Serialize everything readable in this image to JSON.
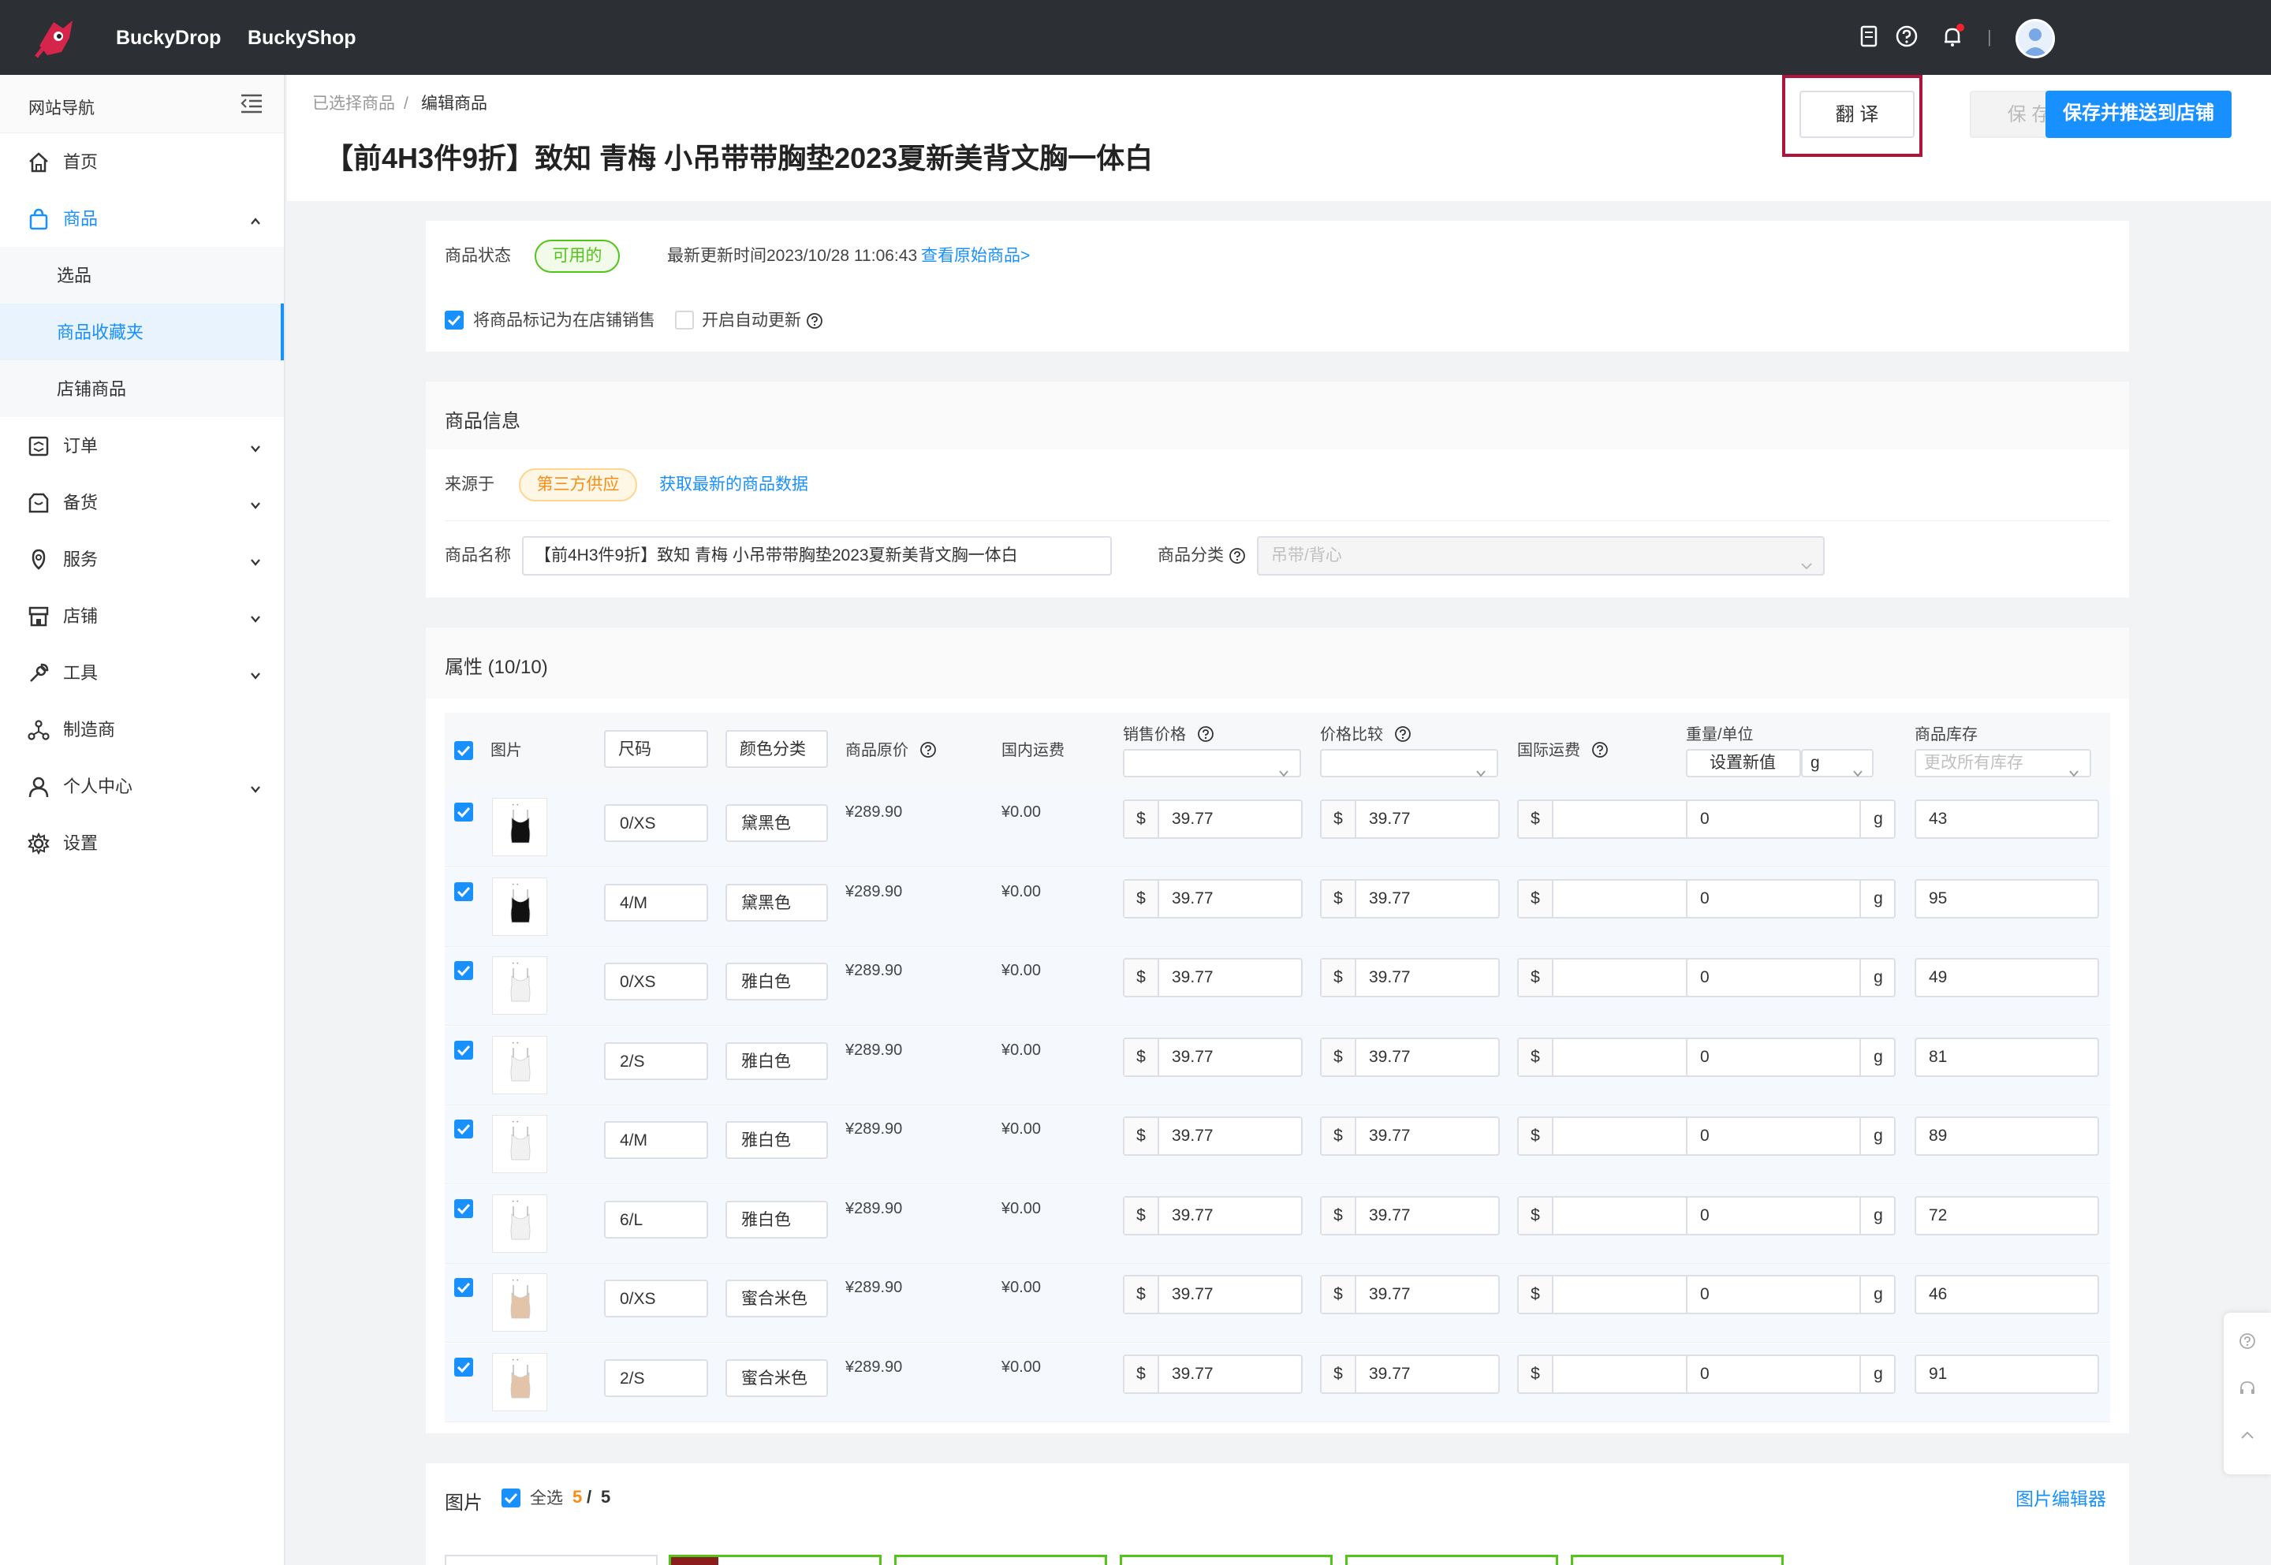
{
  "topbar": {
    "brand1": "BuckyDrop",
    "brand2": "BuckyShop",
    "icons": [
      "document-icon",
      "help-icon",
      "bell-icon"
    ],
    "separator": "|"
  },
  "sidebar": {
    "header": "网站导航",
    "items": [
      {
        "label": "首页",
        "icon": "home-icon"
      },
      {
        "label": "商品",
        "icon": "bag-icon",
        "expanded": true,
        "sub": [
          {
            "label": "选品"
          },
          {
            "label": "商品收藏夹",
            "active": true
          },
          {
            "label": "店铺商品"
          }
        ]
      },
      {
        "label": "订单",
        "icon": "order-icon"
      },
      {
        "label": "备货",
        "icon": "box-icon"
      },
      {
        "label": "服务",
        "icon": "service-icon"
      },
      {
        "label": "店铺",
        "icon": "store-icon"
      },
      {
        "label": "工具",
        "icon": "wrench-icon"
      },
      {
        "label": "制造商",
        "icon": "network-icon"
      },
      {
        "label": "个人中心",
        "icon": "user-icon"
      },
      {
        "label": "设置",
        "icon": "gear-icon"
      }
    ]
  },
  "header": {
    "breadcrumb_1": "已选择商品",
    "breadcrumb_sep": "/",
    "breadcrumb_2": "编辑商品",
    "title": "【前4H3件9折】致知 青梅 小吊带带胸垫2023夏新美背文胸一体白",
    "translate_btn": "翻 译",
    "save_btn": "保 存",
    "save_push_btn": "保存并推送到店铺"
  },
  "status": {
    "label": "商品状态",
    "badge": "可用的",
    "updated": "最新更新时间2023/10/28 11:06:43",
    "view_original": "查看原始商品>",
    "mark_sale": "将商品标记为在店铺销售",
    "auto_update": "开启自动更新"
  },
  "info": {
    "section_title": "商品信息",
    "source_label": "来源于",
    "source_tag": "第三方供应",
    "fetch_link": "获取最新的商品数据",
    "name_label": "商品名称",
    "name_value": "【前4H3件9折】致知 青梅 小吊带带胸垫2023夏新美背文胸一体白",
    "category_label": "商品分类",
    "category_placeholder": "吊带/背心"
  },
  "attributes": {
    "section_title": "属性 (10/10)",
    "headers": {
      "image": "图片",
      "size": "尺码",
      "color": "颜色分类",
      "orig_price": "商品原价",
      "dom_ship": "国内运费",
      "sale_price": "销售价格",
      "compare": "价格比较",
      "intl_ship": "国际运费",
      "weight": "重量/单位",
      "weight_set": "设置新值",
      "weight_unit": "g",
      "stock": "商品库存",
      "stock_placeholder": "更改所有库存"
    },
    "currency": "$",
    "unit": "g",
    "rows": [
      {
        "size": "0/XS",
        "color": "黛黑色",
        "orig": "¥289.90",
        "ship": "¥0.00",
        "price": "39.77",
        "compare": "39.77",
        "weight": "0",
        "stock": "43",
        "swatch": "#111111"
      },
      {
        "size": "4/M",
        "color": "黛黑色",
        "orig": "¥289.90",
        "ship": "¥0.00",
        "price": "39.77",
        "compare": "39.77",
        "weight": "0",
        "stock": "95",
        "swatch": "#111111"
      },
      {
        "size": "0/XS",
        "color": "雅白色",
        "orig": "¥289.90",
        "ship": "¥0.00",
        "price": "39.77",
        "compare": "39.77",
        "weight": "0",
        "stock": "49",
        "swatch": "#f1f1f1"
      },
      {
        "size": "2/S",
        "color": "雅白色",
        "orig": "¥289.90",
        "ship": "¥0.00",
        "price": "39.77",
        "compare": "39.77",
        "weight": "0",
        "stock": "81",
        "swatch": "#f1f1f1"
      },
      {
        "size": "4/M",
        "color": "雅白色",
        "orig": "¥289.90",
        "ship": "¥0.00",
        "price": "39.77",
        "compare": "39.77",
        "weight": "0",
        "stock": "89",
        "swatch": "#f1f1f1"
      },
      {
        "size": "6/L",
        "color": "雅白色",
        "orig": "¥289.90",
        "ship": "¥0.00",
        "price": "39.77",
        "compare": "39.77",
        "weight": "0",
        "stock": "72",
        "swatch": "#f1f1f1"
      },
      {
        "size": "0/XS",
        "color": "蜜合米色",
        "orig": "¥289.90",
        "ship": "¥0.00",
        "price": "39.77",
        "compare": "39.77",
        "weight": "0",
        "stock": "46",
        "swatch": "#e3c4a8"
      },
      {
        "size": "2/S",
        "color": "蜜合米色",
        "orig": "¥289.90",
        "ship": "¥0.00",
        "price": "39.77",
        "compare": "39.77",
        "weight": "0",
        "stock": "91",
        "swatch": "#e3c4a8"
      }
    ]
  },
  "images": {
    "section_title": "图片",
    "select_all": "全选",
    "count_selected": "5",
    "count_sep": "/",
    "count_total": "5",
    "editor_link": "图片编辑器"
  },
  "colors": {
    "primary": "#1890ff",
    "highlight": "#b0133b",
    "success": "#52c41a",
    "warning": "#fa8c16",
    "topbar": "#2c2f34"
  }
}
